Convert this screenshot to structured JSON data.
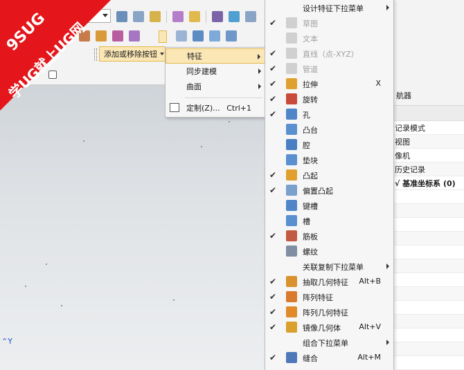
{
  "watermark": {
    "line1": "9SUG",
    "line2": "学UG就上UG网",
    "color": "#e4161b"
  },
  "toolbar": {
    "add_remove_label": "添加或移除按钮"
  },
  "submenu": {
    "items": [
      {
        "label": "特征",
        "highlighted": true,
        "has_arrow": true
      },
      {
        "label": "同步建模",
        "has_arrow": true
      },
      {
        "label": "曲面",
        "has_arrow": true
      },
      {
        "label": "定制(Z)...",
        "shortcut": "Ctrl+1",
        "icon": "customize-icon"
      }
    ]
  },
  "dropdown": {
    "items": [
      {
        "label": "设计特征下拉菜单",
        "check": false,
        "icon": "",
        "shortcut": "",
        "arrow": true
      },
      {
        "label": "草图",
        "check": true,
        "icon": "sketch-icon",
        "disabled": true
      },
      {
        "label": "文本",
        "check": false,
        "icon": "text-icon",
        "disabled": true
      },
      {
        "label": "直线（点-XYZ）",
        "check": true,
        "icon": "line-icon",
        "disabled": true
      },
      {
        "label": "管道",
        "check": true,
        "icon": "tube-icon",
        "disabled": true
      },
      {
        "label": "拉伸",
        "check": true,
        "icon": "extrude-icon",
        "shortcut": "X"
      },
      {
        "label": "旋转",
        "check": true,
        "icon": "revolve-icon"
      },
      {
        "label": "孔",
        "check": true,
        "icon": "hole-icon"
      },
      {
        "label": "凸台",
        "check": false,
        "icon": "boss-icon"
      },
      {
        "label": "腔",
        "check": false,
        "icon": "pocket-icon"
      },
      {
        "label": "垫块",
        "check": false,
        "icon": "pad-icon"
      },
      {
        "label": "凸起",
        "check": true,
        "icon": "emboss-icon"
      },
      {
        "label": "偏置凸起",
        "check": true,
        "icon": "offset-emboss-icon"
      },
      {
        "label": "键槽",
        "check": false,
        "icon": "slot-icon"
      },
      {
        "label": "槽",
        "check": false,
        "icon": "groove-icon"
      },
      {
        "label": "筋板",
        "check": true,
        "icon": "rib-icon"
      },
      {
        "label": "螺纹",
        "check": false,
        "icon": "thread-icon"
      },
      {
        "label": "关联复制下拉菜单",
        "check": false,
        "icon": "",
        "arrow": true
      },
      {
        "label": "抽取几何特征",
        "check": true,
        "icon": "extract-geometry-icon",
        "shortcut": "Alt+B"
      },
      {
        "label": "阵列特征",
        "check": true,
        "icon": "pattern-feature-icon"
      },
      {
        "label": "阵列几何特征",
        "check": true,
        "icon": "pattern-geometry-icon"
      },
      {
        "label": "镜像几何体",
        "check": true,
        "icon": "mirror-geometry-icon",
        "shortcut": "Alt+V"
      },
      {
        "label": "组合下拉菜单",
        "check": false,
        "icon": "",
        "arrow": true
      },
      {
        "label": "缝合",
        "check": true,
        "icon": "sew-icon",
        "shortcut": "Alt+M"
      }
    ]
  },
  "navigator": {
    "header": "航器",
    "rows": [
      {
        "label": "记录模式"
      },
      {
        "label": "视图"
      },
      {
        "label": "像机"
      },
      {
        "label": "历史记录"
      },
      {
        "label": "√ 基准坐标系 (0)",
        "bold": true
      }
    ]
  },
  "viewport": {
    "axis_label": "Y"
  },
  "colors": {
    "highlight": "#fbe7b6",
    "highlight_border": "#e2b94e",
    "axis": "#1a4fd8"
  }
}
